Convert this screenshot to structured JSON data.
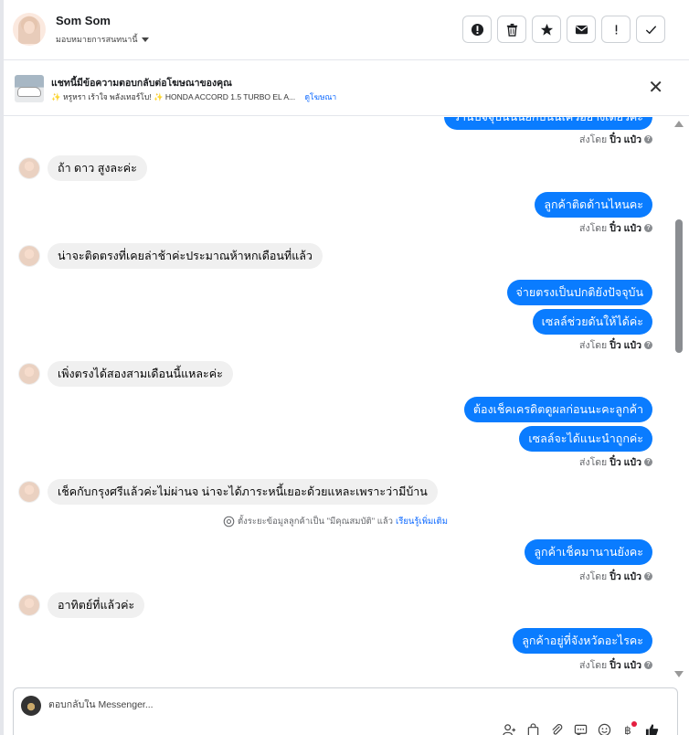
{
  "header": {
    "contact_name": "Som Som",
    "assign_label": "มอบหมายการสนทนานี้",
    "actions": [
      {
        "name": "report-spam-button",
        "icon": "alert-circle-icon"
      },
      {
        "name": "delete-button",
        "icon": "trash-icon"
      },
      {
        "name": "star-button",
        "icon": "star-icon"
      },
      {
        "name": "mark-unread-button",
        "icon": "envelope-icon"
      },
      {
        "name": "follow-up-button",
        "icon": "exclamation-icon"
      },
      {
        "name": "mark-done-button",
        "icon": "check-icon"
      }
    ]
  },
  "banner": {
    "title": "แชทนี้มีข้อความตอบกลับต่อโฆษณาของคุณ",
    "ad_text": "✨ หรูหรา เร้าใจ พลังเทอร์โบ! ✨ HONDA ACCORD 1.5 TURBO EL A...",
    "link": "ดูโฆษณา"
  },
  "messages": {
    "out_top_partial": "วานปจจุบนนนยกบนนเควอยางเดยวคะ",
    "in_1": "ถ้า ดาว สูงละค่ะ",
    "out_1": "ลูกค้าติดด้านไหนคะ",
    "in_2": "น่าจะติดตรงที่เคยล่าช้าค่ะประมาณห้าหกเดือนที่แล้ว",
    "out_2a": "จ่ายตรงเป็นปกติยังปัจจุบัน",
    "out_2b": "เซลล์ช่วยดันให้ได้ค่ะ",
    "in_3": "เพิ่งตรงได้สองสามเดือนนี้แหละค่ะ",
    "out_3a": "ต้องเช็คเครดิตดูผลก่อนนะคะลูกค้า",
    "out_3b": "เซลล์จะได้แนะนำถูกค่ะ",
    "in_4": "เช็คกับกรุงศรีแล้วค่ะไม่ผ่านจ น่าจะได้ภาระหนี้เยอะด้วยแหละเพราะว่ามีบ้าน",
    "system_text": "ตั้งระยะข้อมูลลูกค้าเป็น \"มีคุณสมบัติ\" แล้ว",
    "system_link": "เรียนรู้เพิ่มเติม",
    "out_4": "ลูกค้าเช็คมานานยังคะ",
    "in_5": "อาทิตย์ที่แล้วค่ะ",
    "out_5": "ลูกค้าอยู่ที่จังหวัดอะไรคะ"
  },
  "sent_by": {
    "prefix": "ส่งโดย",
    "name": "ปิ๋ว แป๋ว"
  },
  "composer": {
    "placeholder": "ตอบกลับใน Messenger..."
  },
  "colors": {
    "outgoing_bubble": "#0a7cff",
    "incoming_bubble": "#f0f0f0",
    "link": "#0866ff"
  }
}
